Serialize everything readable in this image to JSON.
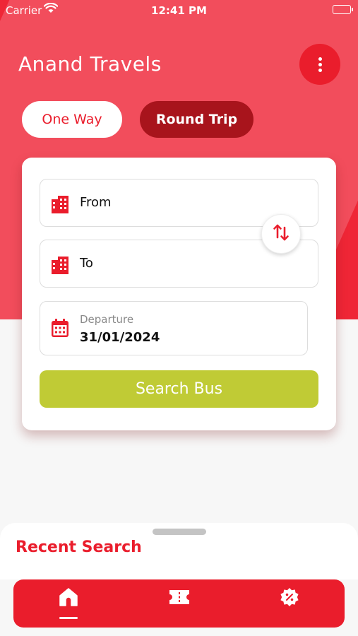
{
  "status_bar": {
    "carrier": "Carrier",
    "time": "12:41 PM"
  },
  "header": {
    "title": "Anand Travels",
    "menu_icon": "more-vertical-icon"
  },
  "trip_type": {
    "tabs": [
      {
        "label": "One Way",
        "selected": false
      },
      {
        "label": "Round Trip",
        "selected": true
      }
    ]
  },
  "search_form": {
    "from": {
      "label": "From",
      "icon": "building-icon"
    },
    "to": {
      "label": "To",
      "icon": "building-icon"
    },
    "swap_icon": "swap-vertical-icon",
    "departure": {
      "label": "Departure",
      "value": "31/01/2024",
      "icon": "calendar-icon"
    },
    "search_button": "Search Bus"
  },
  "recent": {
    "title": "Recent Search"
  },
  "bottom_nav": {
    "items": [
      "home-icon",
      "ticket-icon",
      "offer-icon"
    ]
  },
  "colors": {
    "primary": "#ea1d2c",
    "accent_dark": "#a8141c",
    "search_button": "#c0cb35",
    "background": "#f7f7f7"
  }
}
